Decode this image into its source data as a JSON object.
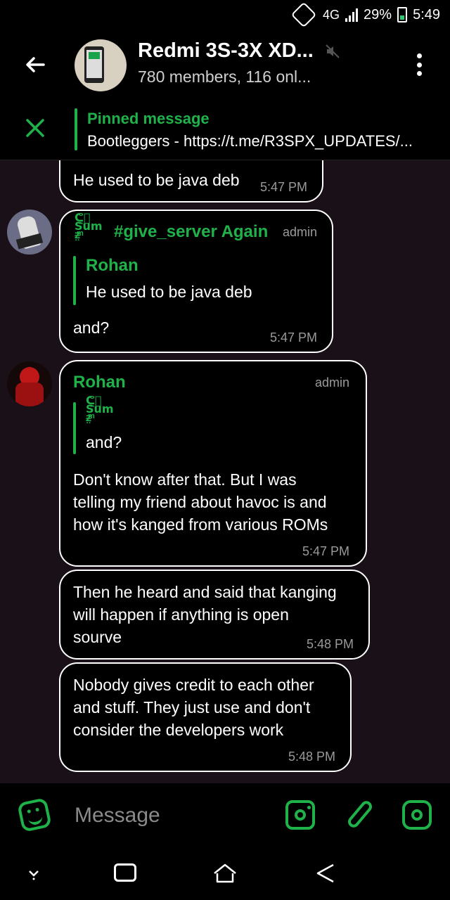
{
  "status_bar": {
    "network": "4G",
    "battery": "29%",
    "time": "5:49"
  },
  "header": {
    "title": "Redmi 3S-3X XD...",
    "subtitle": "780 members, 116 onl..."
  },
  "pinned": {
    "title": "Pinned message",
    "text": "Bootleggers - https://t.me/R3SPX_UPDATES/..."
  },
  "messages": [
    {
      "text": "He used to be java deb",
      "time": "5:47 PM"
    },
    {
      "sender": "#give_server Again",
      "role": "admin",
      "reply_to": {
        "name": "Rohan",
        "text": "He used to be java deb"
      },
      "text": "and?",
      "time": "5:47 PM"
    },
    {
      "sender": "Rohan",
      "role": "admin",
      "reply_to": {
        "text": "and?"
      },
      "text_lines": [
        "Don't know after that. But I was",
        "telling my friend about havoc is and",
        "how it's kanged from various ROMs"
      ],
      "time": "5:47 PM"
    },
    {
      "text_lines": [
        "Then he heard and said that kanging",
        "will happen if anything is open",
        "sourve"
      ],
      "time": "5:48 PM"
    },
    {
      "text_lines": [
        "Nobody gives credit to each other",
        "and stuff. They just use and don't",
        "consider the developers work"
      ],
      "time": "5:48 PM"
    }
  ],
  "input": {
    "placeholder": "Message"
  },
  "colors": {
    "accent": "#1fb24a",
    "bubble_bg": "#000000",
    "chat_bg": "#1a1118"
  }
}
